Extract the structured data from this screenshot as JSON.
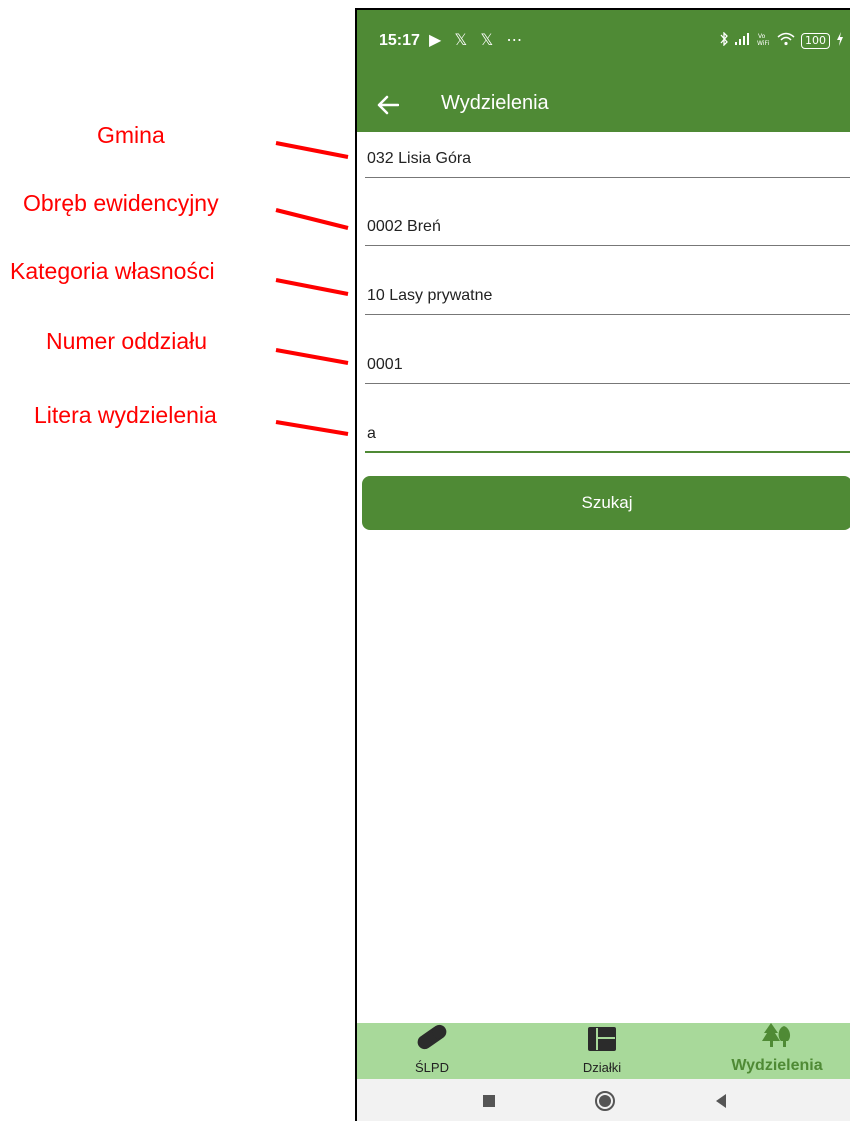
{
  "annotations": {
    "gmina": "Gmina",
    "obreb": "Obręb ewidencyjny",
    "kategoria": "Kategoria własności",
    "numer": "Numer oddziału",
    "litera": "Litera wydzielenia"
  },
  "status_bar": {
    "time": "15:17",
    "left_icons": "▶ 𝕏 𝕏 ⋯",
    "battery": "100"
  },
  "app_bar": {
    "title": "Wydzielenia"
  },
  "form": {
    "gmina": "032 Lisia Góra",
    "obreb": "0002 Breń",
    "kategoria": "10 Lasy prywatne",
    "numer_oddzialu": "0001",
    "litera": "a"
  },
  "search_button": "Szukaj",
  "bottom_nav": {
    "items": [
      {
        "label": "ŚLPD",
        "icon": "binoculars-icon"
      },
      {
        "label": "Działki",
        "icon": "map-grid-icon"
      },
      {
        "label": "Wydzielenia",
        "icon": "trees-icon"
      }
    ],
    "active": "Wydzielenia"
  },
  "colors": {
    "primary": "#4f8a35",
    "nav_bg": "#a8d99a",
    "annotation": "#ff0000"
  }
}
